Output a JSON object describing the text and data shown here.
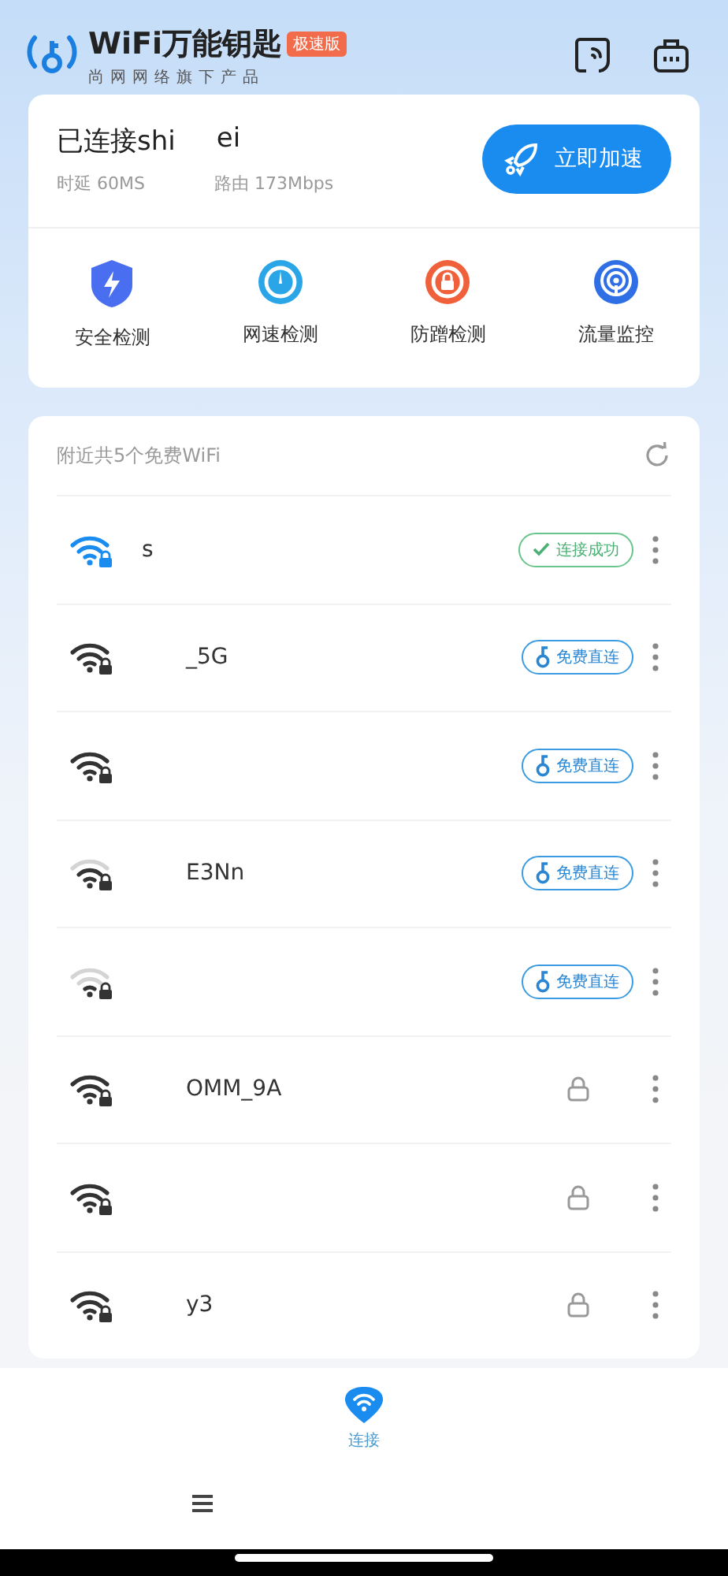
{
  "header": {
    "app_name": "WiFi万能钥匙",
    "badge": "极速版",
    "tagline": "尚网网络旗下产品"
  },
  "status": {
    "title_parts": [
      "已连接shi",
      "ei"
    ],
    "stats": [
      "时延 60MS",
      "路由 173Mbps"
    ],
    "boost_button": "立即加速"
  },
  "tools": [
    {
      "label": "安全检测",
      "kind": "shield"
    },
    {
      "label": "网速检测",
      "kind": "speed"
    },
    {
      "label": "防蹭检测",
      "kind": "guard"
    },
    {
      "label": "流量监控",
      "kind": "traffic"
    }
  ],
  "nearby": {
    "title": "附近共5个免费WiFi",
    "networks": [
      {
        "ssid": "s",
        "kind": "connected",
        "action": {
          "kind": "connected",
          "label": "连接成功"
        }
      },
      {
        "ssid": "_5G",
        "kind": "full",
        "action": {
          "kind": "free",
          "label": "免费直连"
        }
      },
      {
        "kind": "full",
        "action": {
          "kind": "free",
          "label": "免费直连"
        }
      },
      {
        "ssid": "E3Nn",
        "kind": "medium",
        "action": {
          "kind": "free",
          "label": "免费直连"
        }
      },
      {
        "kind": "low",
        "action": {
          "kind": "free",
          "label": "免费直连"
        }
      },
      {
        "ssid": "OMM_9A",
        "kind": "full",
        "action": {
          "kind": "locked"
        }
      },
      {
        "kind": "full",
        "action": {
          "kind": "locked"
        }
      },
      {
        "ssid": "y3",
        "kind": "full",
        "action": {
          "kind": "locked"
        }
      }
    ]
  },
  "bottom_nav": [
    {
      "label": "连接",
      "selected": true
    }
  ]
}
